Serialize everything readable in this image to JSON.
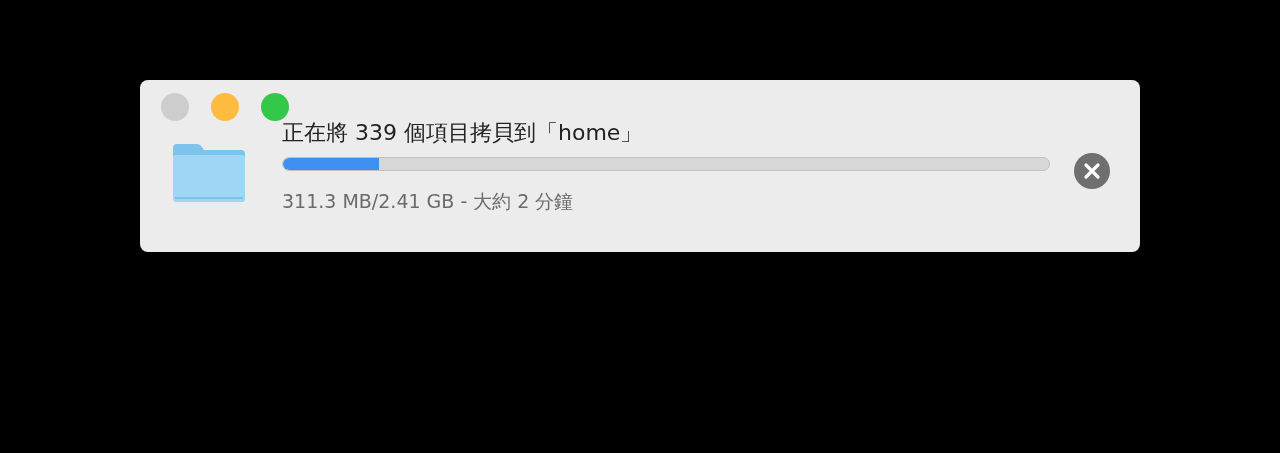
{
  "window": {
    "traffic_lights": [
      {
        "color": "#cdcdcd"
      },
      {
        "color": "#fdbc40"
      },
      {
        "color": "#34c84a"
      }
    ]
  },
  "copy": {
    "title": "正在將 339 個項目拷貝到「home」",
    "level": 0.125,
    "status": "311.3 MB/2.41 GB - 大約 2 分鐘"
  }
}
